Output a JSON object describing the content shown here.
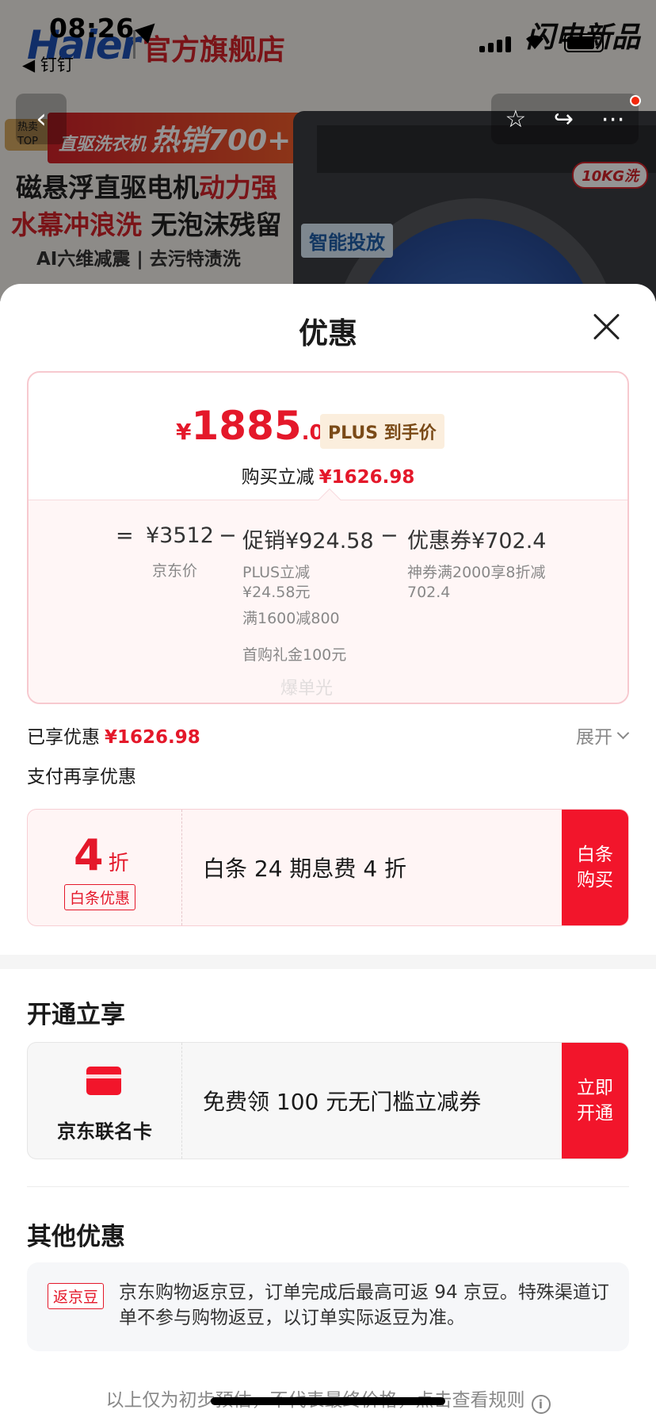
{
  "status_bar": {
    "time": "08:26",
    "back_app": "◀ 钉钉"
  },
  "background": {
    "brand": "Haier",
    "store_name": "官方旗舰店",
    "new_product_logo": "闪电新品",
    "top_tag": "热卖\nTOP",
    "hot_strip_prefix": "直驱洗衣机",
    "hot_strip_main": "热销700+",
    "line1_a": "磁悬浮直驱电机",
    "line1_b": "动力强",
    "line2_a": "水幕冲浪洗",
    "line2_b": "无泡沫残留",
    "line3": "AI六维减震 | 去污特渍洗",
    "smart_dispense": "智能投放",
    "capacity_badge": "10KG洗"
  },
  "sheet": {
    "title": "优惠",
    "price": {
      "currency": "¥",
      "integer": "1885",
      "decimal": ".02",
      "plus_label": "PLUS 到手价",
      "reduce_label": "购买立减",
      "reduce_amount": "¥1626.98"
    },
    "breakdown": {
      "eq": "=",
      "jd_price": "¥3512",
      "jd_label": "京东价",
      "minus": "−",
      "promo": "促销¥924.58",
      "promo_items": [
        "PLUS立减¥24.58元",
        "满1600减800",
        "首购礼金100元"
      ],
      "coupon": "优惠券¥702.4",
      "coupon_items": [
        "神券满2000享8折减702.4"
      ],
      "watermark": "爆单光"
    },
    "enjoyed_label": "已享优惠",
    "enjoyed_amount": "¥1626.98",
    "expand_label": "展开",
    "pay_more_label": "支付再享优惠",
    "baitiao": {
      "discount_num": "4",
      "discount_unit": "折",
      "tag": "白条优惠",
      "desc": "白条 24 期息费 4 折",
      "cta": "白条购买"
    },
    "open_section_title": "开通立享",
    "jd_card": {
      "name": "京东联名卡",
      "desc": "免费领 100 元无门槛立减券",
      "cta": "立即开通"
    },
    "other_section_title": "其他优惠",
    "bean": {
      "tag": "返京豆",
      "text": "京东购物返京豆，订单完成后最高可返 94 京豆。特殊渠道订单不参与购物返豆，以订单实际返豆为准。"
    },
    "footer_note": "以上仅为初步预估，不代表最终价格，点击查看规则"
  },
  "colors": {
    "accent_red": "#e4182a",
    "cta_red": "#f2152b",
    "plus_gold": "#7a4a17"
  }
}
